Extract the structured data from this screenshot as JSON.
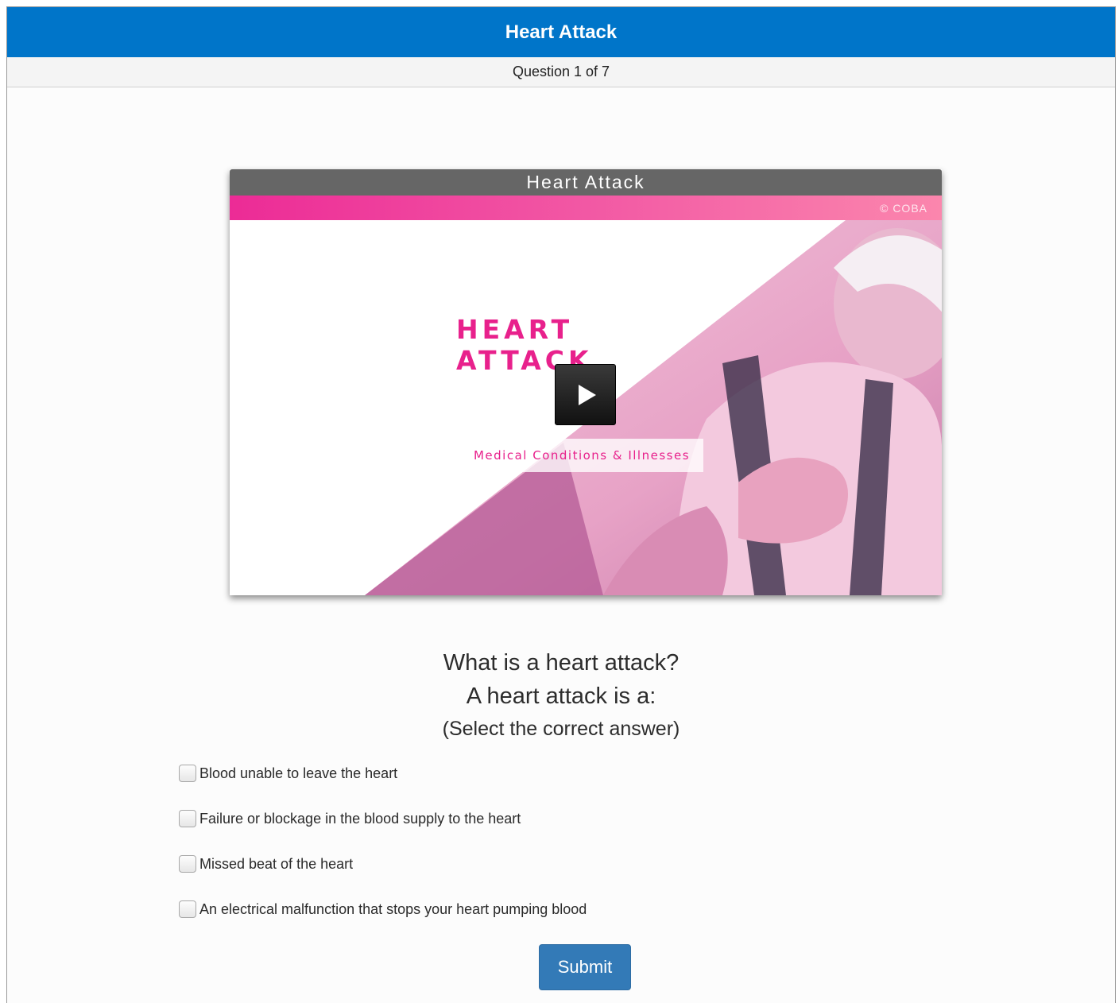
{
  "header": {
    "title": "Heart Attack"
  },
  "progress": {
    "label": "Question 1 of 7",
    "current": 1,
    "total": 7
  },
  "video": {
    "title": "Heart Attack",
    "copyright": "© COBA",
    "heading": "HEART ATTACK",
    "subtitle": "Medical Conditions & Illnesses",
    "play_icon": "play-icon",
    "accent_color": "#e8218c"
  },
  "question": {
    "line1": "What is a heart attack?",
    "line2": "A heart attack is a:",
    "line3": "(Select the correct answer)"
  },
  "options": [
    {
      "label": "Blood unable to leave the heart",
      "checked": false
    },
    {
      "label": "Failure or blockage in the blood supply to the heart",
      "checked": false
    },
    {
      "label": "Missed beat of the heart",
      "checked": false
    },
    {
      "label": "An electrical malfunction that stops your heart pumping blood",
      "checked": false
    }
  ],
  "submit": {
    "label": "Submit"
  },
  "colors": {
    "header_bg": "#0075c9",
    "button_bg": "#337ab7"
  }
}
